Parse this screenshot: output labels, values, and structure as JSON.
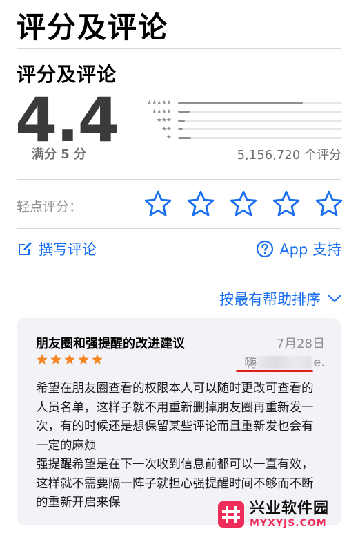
{
  "header": {
    "title": "评分及评论"
  },
  "ratings": {
    "section_title": "评分及评论",
    "average": "4.4",
    "out_of": "满分 5 分",
    "count_text": "5,156,720 个评分",
    "histogram": [
      {
        "stars": 5,
        "fraction": 0.76
      },
      {
        "stars": 4,
        "fraction": 0.07
      },
      {
        "stars": 3,
        "fraction": 0.04
      },
      {
        "stars": 2,
        "fraction": 0.03
      },
      {
        "stars": 1,
        "fraction": 0.08
      }
    ]
  },
  "tap_to_rate": {
    "label": "轻点评分：",
    "star_count": 5
  },
  "actions": {
    "write_review": "撰写评论",
    "app_support": "App 支持"
  },
  "sort": {
    "label": "按最有帮助排序"
  },
  "review": {
    "title": "朋友圈和强提醒的改进建议",
    "date": "7月28日",
    "rating": 5,
    "author_prefix": "嗨",
    "author_suffix": "e.",
    "body_lines": [
      "希望在朋友圈查看的权限本人可以随时更改可查看的人员名单，这样子就不用重新删掉朋友圈再重新发一次，有的时候还是想保留某些评论而且重新发也会有一定的麻烦",
      "强提醒希望是在下一次收到信息前都可以一直有效，这样就不需要隔一阵子就担心强提醒时间不够而不断的重新开启来保"
    ]
  },
  "watermark": {
    "name": "兴业软件园",
    "domain": "MYXYJS.COM"
  },
  "colors": {
    "accent": "#1a6ff0",
    "star_orange": "#f5831f",
    "grey": "#8e8e93"
  },
  "icons": {
    "write": "compose-icon",
    "support": "question-circle-icon",
    "sort": "chevron-down-icon"
  }
}
